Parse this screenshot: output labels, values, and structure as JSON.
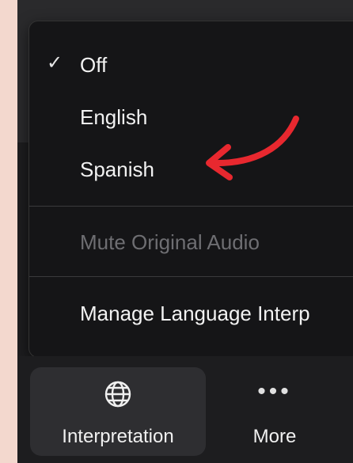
{
  "menu": {
    "items": [
      {
        "label": "Off",
        "checked": true,
        "enabled": true
      },
      {
        "label": "English",
        "checked": false,
        "enabled": true
      },
      {
        "label": "Spanish",
        "checked": false,
        "enabled": true
      },
      {
        "label": "Mute Original Audio",
        "checked": false,
        "enabled": false
      },
      {
        "label": "Manage Language Interp",
        "checked": false,
        "enabled": true
      }
    ],
    "checkmark": "✓"
  },
  "toolbar": {
    "interpretation_label": "Interpretation",
    "more_label": "More",
    "more_glyph": "•••"
  },
  "annotation": {
    "arrow_color": "#e8282f"
  },
  "icons": {
    "interpretation": "globe-icon",
    "more": "ellipsis-icon"
  },
  "colors": {
    "menu_bg": "#151517",
    "toolbar_bg": "#1d1d1f",
    "active_button_bg": "#2e2e31",
    "page_bg": "#f3d8ce"
  }
}
